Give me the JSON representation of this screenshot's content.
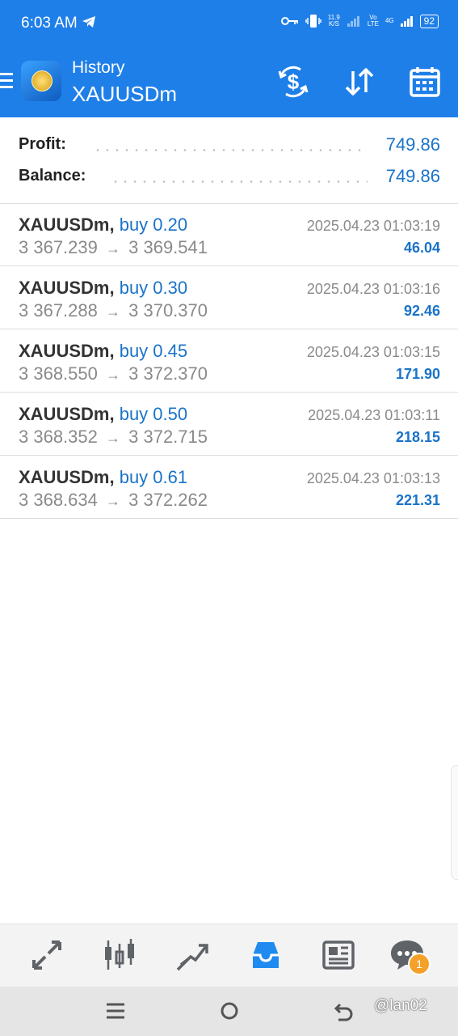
{
  "status_bar": {
    "time": "6:03 AM",
    "net_speed_value": "11.9",
    "net_speed_unit": "K/S",
    "volte_top": "Vo",
    "volte_bottom": "LTE",
    "network": "4G",
    "battery": "92"
  },
  "header": {
    "subtitle": "History",
    "title": "XAUUSDm",
    "icons": [
      "currency-exchange-icon",
      "sort-icon",
      "calendar-icon"
    ]
  },
  "summary": {
    "profit_label": "Profit:",
    "profit_value": "749.86",
    "balance_label": "Balance:",
    "balance_value": "749.86"
  },
  "trades": [
    {
      "symbol": "XAUUSDm,",
      "side": "buy 0.20",
      "open": "3 367.239",
      "close": "3 369.541",
      "time": "2025.04.23 01:03:19",
      "profit": "46.04"
    },
    {
      "symbol": "XAUUSDm,",
      "side": "buy 0.30",
      "open": "3 367.288",
      "close": "3 370.370",
      "time": "2025.04.23 01:03:16",
      "profit": "92.46"
    },
    {
      "symbol": "XAUUSDm,",
      "side": "buy 0.45",
      "open": "3 368.550",
      "close": "3 372.370",
      "time": "2025.04.23 01:03:15",
      "profit": "171.90"
    },
    {
      "symbol": "XAUUSDm,",
      "side": "buy 0.50",
      "open": "3 368.352",
      "close": "3 372.715",
      "time": "2025.04.23 01:03:11",
      "profit": "218.15"
    },
    {
      "symbol": "XAUUSDm,",
      "side": "buy 0.61",
      "open": "3 368.634",
      "close": "3 372.262",
      "time": "2025.04.23 01:03:13",
      "profit": "221.31"
    }
  ],
  "arrow": "→",
  "bottom_nav": {
    "items": [
      "quotes-icon",
      "chart-icon",
      "trade-icon",
      "history-icon",
      "news-icon",
      "messages-icon"
    ],
    "active": "history-icon",
    "messages_badge": "1"
  },
  "watermark": "@lan02",
  "colors": {
    "header_blue": "#1f7fe8",
    "accent_blue": "#1a73c9",
    "badge_orange": "#f4a12a"
  }
}
